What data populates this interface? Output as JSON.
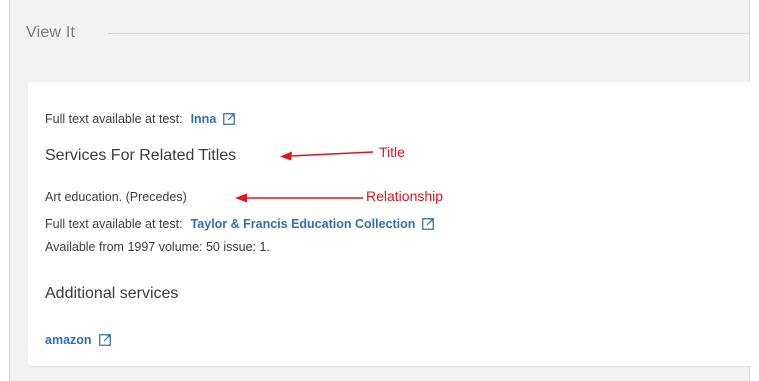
{
  "section": {
    "title": "View It"
  },
  "full_text": {
    "label": "Full text available at test:",
    "link": "Inna"
  },
  "related": {
    "heading": "Services For Related Titles",
    "relation_text": "Art education. (Precedes)",
    "label": "Full text available at test:",
    "link": "Taylor & Francis Education Collection",
    "availability": "Available from 1997 volume: 50 issue: 1."
  },
  "additional": {
    "heading": "Additional services",
    "link": "amazon"
  },
  "annotations": {
    "title_label": "Title",
    "relationship_label": "Relationship",
    "color": "#e3151a"
  },
  "colors": {
    "link": "#2f6fb1",
    "panel_background": "#f2f2f2"
  },
  "icons": {
    "external": "external-link-icon",
    "arrow": "red-arrow-icon"
  }
}
